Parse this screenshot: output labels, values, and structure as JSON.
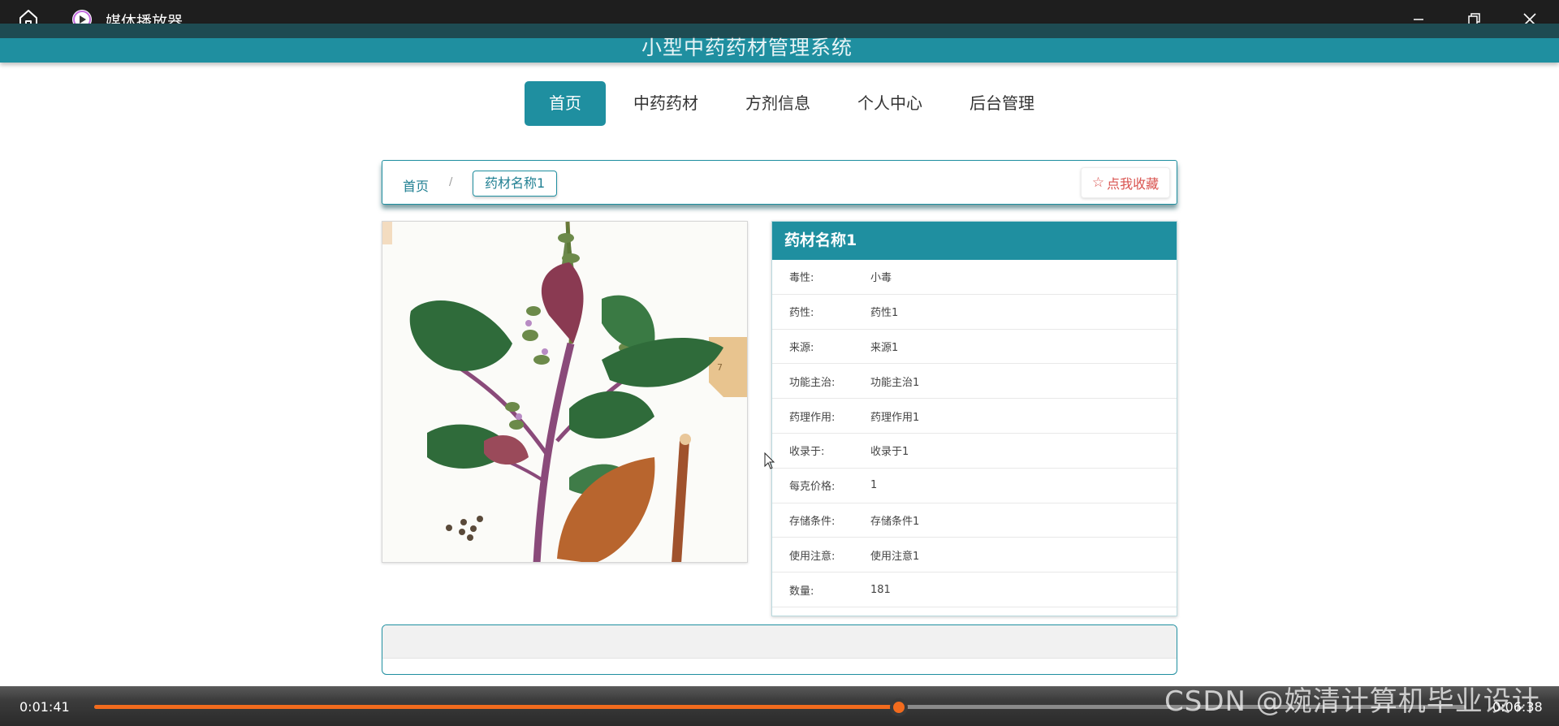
{
  "player": {
    "title": "媒体播放器",
    "current_time": "0:01:41",
    "total_time": "0:06:38",
    "progress": 0.587,
    "accent": "#f26b1d"
  },
  "site": {
    "title": "小型中药药材管理系统",
    "theme_color": "#1f8fa0"
  },
  "nav": {
    "items": [
      "首页",
      "中药药材",
      "方剂信息",
      "个人中心",
      "后台管理"
    ],
    "active_index": 0
  },
  "breadcrumb": {
    "home": "首页",
    "separator": "/",
    "current": "药材名称1"
  },
  "favorite_button": {
    "icon": "star-outline-icon",
    "label": "点我收藏"
  },
  "herb_image": {
    "description_icon": "herb-illustration"
  },
  "details": {
    "title": "药材名称1",
    "rows": [
      {
        "label": "毒性:",
        "value": "小毒"
      },
      {
        "label": "药性:",
        "value": "药性1"
      },
      {
        "label": "来源:",
        "value": "来源1"
      },
      {
        "label": "功能主治:",
        "value": "功能主治1"
      },
      {
        "label": "药理作用:",
        "value": "药理作用1"
      },
      {
        "label": "收录于:",
        "value": "收录于1"
      },
      {
        "label": "每克价格:",
        "value": "1"
      },
      {
        "label": "存储条件:",
        "value": "存储条件1"
      },
      {
        "label": "使用注意:",
        "value": "使用注意1"
      },
      {
        "label": "数量:",
        "value": "181"
      }
    ]
  },
  "watermark": "CSDN @婉清计算机毕业设计"
}
